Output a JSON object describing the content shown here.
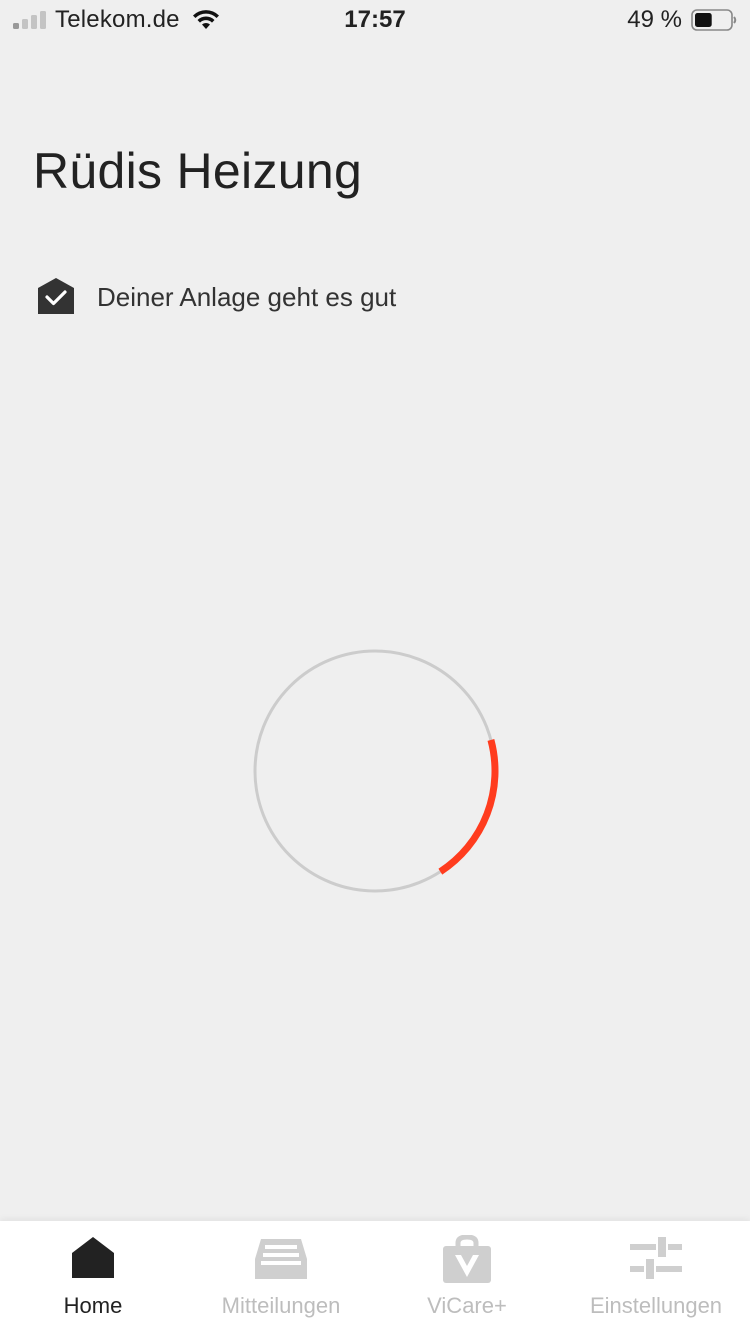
{
  "status_bar": {
    "carrier": "Telekom.de",
    "time": "17:57",
    "battery_percent": "49 %",
    "battery_level": 0.49,
    "signal_bars_active": 1,
    "icons": [
      "signal-icon",
      "wifi-icon",
      "battery-icon"
    ]
  },
  "header": {
    "title": "Rüdis Heizung"
  },
  "system_status": {
    "icon": "house-check-icon",
    "text": "Deiner Anlage geht es gut"
  },
  "loading": {
    "icon": "loading-spinner",
    "track_color": "#cccccc",
    "accent_color": "#ff3c1e",
    "arc_fraction": 0.2
  },
  "tab_bar": {
    "tabs": [
      {
        "label": "Home",
        "icon": "home-icon",
        "active": true
      },
      {
        "label": "Mitteilungen",
        "icon": "inbox-icon",
        "active": false
      },
      {
        "label": "ViCare+",
        "icon": "vicare-bag-icon",
        "active": false
      },
      {
        "label": "Einstellungen",
        "icon": "sliders-icon",
        "active": false
      }
    ],
    "active_color": "#222222",
    "inactive_color": "#bdbdbd"
  }
}
